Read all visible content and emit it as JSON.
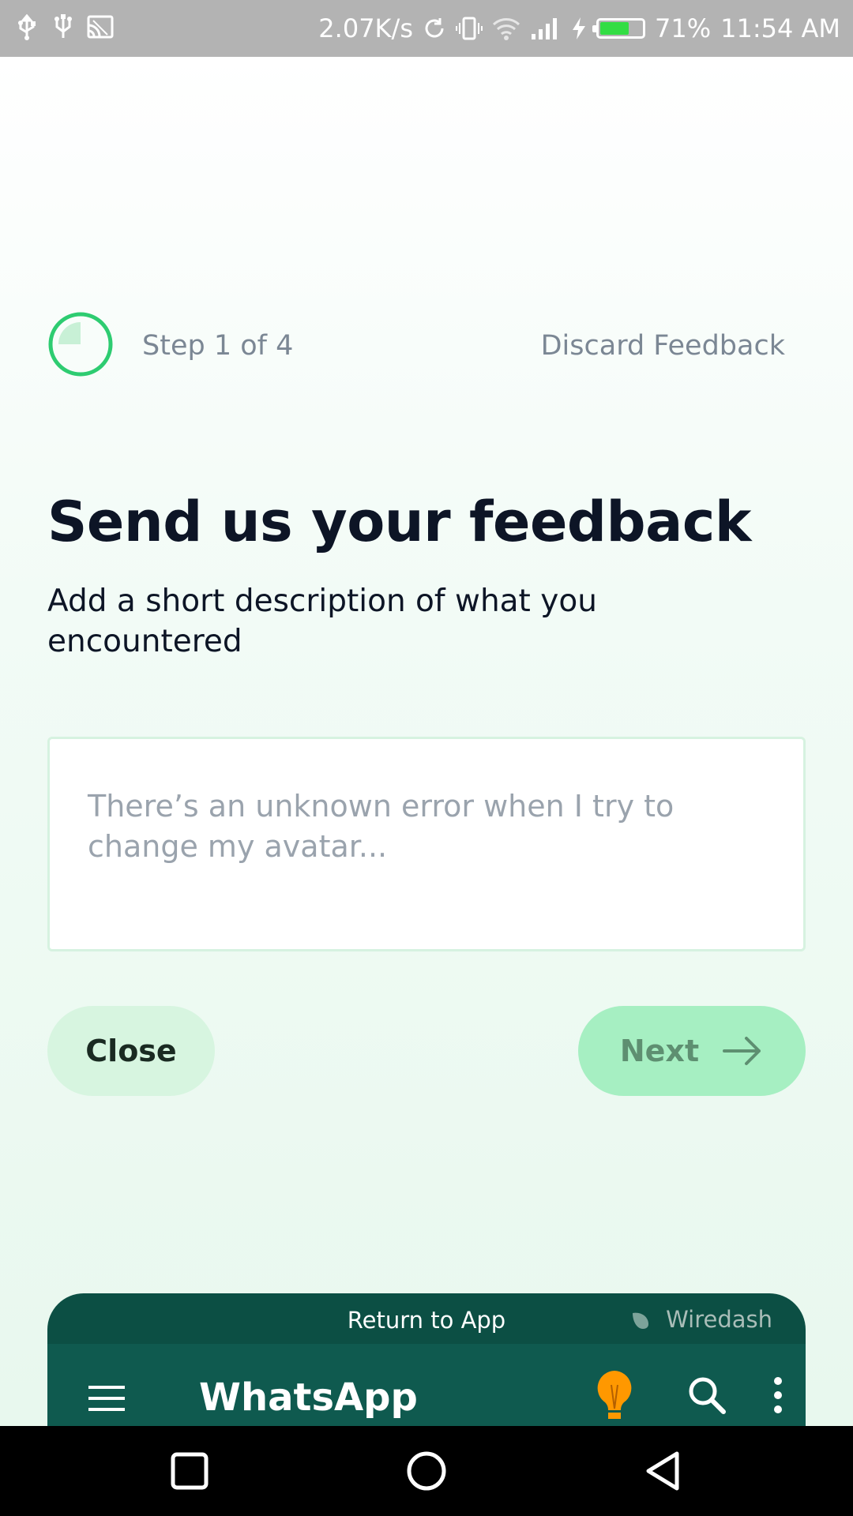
{
  "status_bar": {
    "network_speed": "2.07K/s",
    "battery_percent": "71%",
    "battery_level": 0.71,
    "time": "11:54 AM",
    "left_icons": [
      "usb-icon",
      "usb-icon",
      "cast-icon"
    ],
    "right_icons": [
      "sync-icon",
      "vibrate-icon",
      "wifi-icon",
      "signal-icon",
      "charging-icon",
      "battery-icon"
    ]
  },
  "feedback": {
    "step_label": "Step 1 of 4",
    "step_progress": 0.25,
    "discard_label": "Discard Feedback",
    "title": "Send us your feedback",
    "subtitle": "Add a short description of what you encountered",
    "input_placeholder": "There’s an unknown error when I try to change my avatar...",
    "input_value": "",
    "close_label": "Close",
    "next_label": "Next",
    "accent_color": "#2ecc71"
  },
  "app_preview": {
    "return_label": "Return to App",
    "brand_label": "Wiredash",
    "app_title": "WhatsApp",
    "icons": [
      "menu-icon",
      "lightbulb-icon",
      "search-icon",
      "more-vert-icon"
    ]
  },
  "nav_bar": {
    "buttons": [
      "recents-button",
      "home-button",
      "back-button"
    ]
  }
}
